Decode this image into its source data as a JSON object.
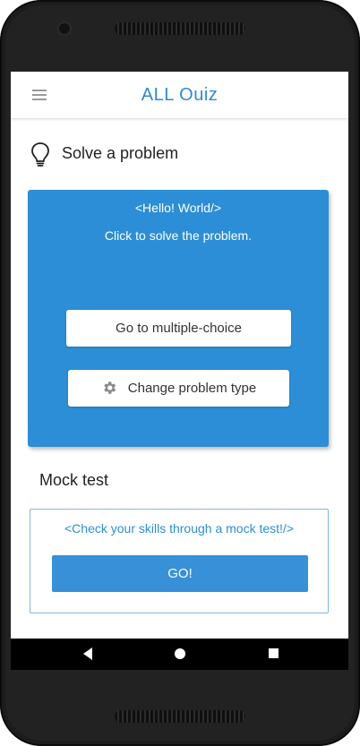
{
  "app": {
    "title": "ALL Ouiz"
  },
  "icons": {
    "menu": "hamburger-menu-icon",
    "section": "lightbulb-icon",
    "settings": "gear-icon",
    "nav_back": "triangle-back-icon",
    "nav_home": "circle-home-icon",
    "nav_recent": "square-recents-icon"
  },
  "solve": {
    "title": "Solve a problem",
    "code_text": "<Hello! World/>",
    "prompt": "Click to solve the  problem.",
    "multiple_choice_label": "Go to multiple-choice",
    "change_type_label": "Change problem type"
  },
  "mock": {
    "title": "Mock test",
    "description": "<Check your skills through a mock test!/>",
    "go_label": "GO!"
  },
  "colors": {
    "accent": "#2c8ed6",
    "button_blue": "#3790d8",
    "card_border": "#7fb6e3",
    "text_dark": "#222222"
  }
}
